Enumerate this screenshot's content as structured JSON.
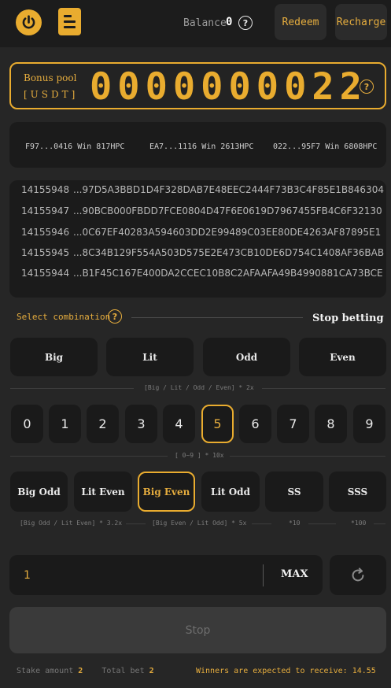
{
  "header": {
    "power_icon": "power-icon",
    "doc_icon": "document-icon",
    "balance_label": "Balance",
    "balance_value": "0",
    "help": "?",
    "redeem_label": "Redeem",
    "recharge_label": "Recharge"
  },
  "bonus_pool": {
    "label": "Bonus pool",
    "unit": "[USDT]",
    "value": "0000000022",
    "help": "?"
  },
  "winners": [
    "F97...0416 Win 817HPC",
    "EA7...1116 Win 2613HPC",
    "022...95F7 Win 6808HPC"
  ],
  "hashes": [
    {
      "id": "14155948",
      "hash": "...97D5A3BBD1D4F328DAB7E48EEC2444F73B3C4F85E1B846304"
    },
    {
      "id": "14155947",
      "hash": "...90BCB000FBDD7FCE0804D47F6E0619D7967455FB4C6F32130"
    },
    {
      "id": "14155946",
      "hash": "...0C67EF40283A594603DD2E99489C03EE80DE4263AF87895E1"
    },
    {
      "id": "14155945",
      "hash": "...8C34B129F554A503D575E2E473CB10DE6D754C1408AF36BAB"
    },
    {
      "id": "14155944",
      "hash": "...B1F45C167E400DA2CCEC10B8C2AFAAFA49B4990881CA73BCE"
    }
  ],
  "selection": {
    "label": "Select combination",
    "help": "?",
    "status": "Stop betting"
  },
  "basic_options": [
    "Big",
    "Lit",
    "Odd",
    "Even"
  ],
  "basic_hint": "[Big / Lit / Odd / Even] * 2x",
  "digits": [
    "0",
    "1",
    "2",
    "3",
    "4",
    "5",
    "6",
    "7",
    "8",
    "9"
  ],
  "selected_digit": "5",
  "digit_hint": "[ 0~9 ] * 10x",
  "combo_options": [
    "Big Odd",
    "Lit Even",
    "Big Even",
    "Lit Odd",
    "SS",
    "SSS"
  ],
  "selected_combo": "Big Even",
  "combo_hints": [
    "[Big Odd / Lit Even] * 3.2x",
    "[Big Even / Lit Odd] * 5x",
    "*10",
    "*100"
  ],
  "amount": {
    "value": "1",
    "max_label": "MAX",
    "refresh_icon": "refresh-icon"
  },
  "stop_button_label": "Stop",
  "footer": {
    "stake_label": "Stake amount",
    "stake_value": "2",
    "total_label": "Total bet",
    "total_value": "2",
    "expected_label": "Winners are expected to receive:",
    "expected_value": "14.55"
  },
  "colors": {
    "accent": "#e9ac2f",
    "background": "#262626",
    "panel": "#1a1a1a"
  }
}
